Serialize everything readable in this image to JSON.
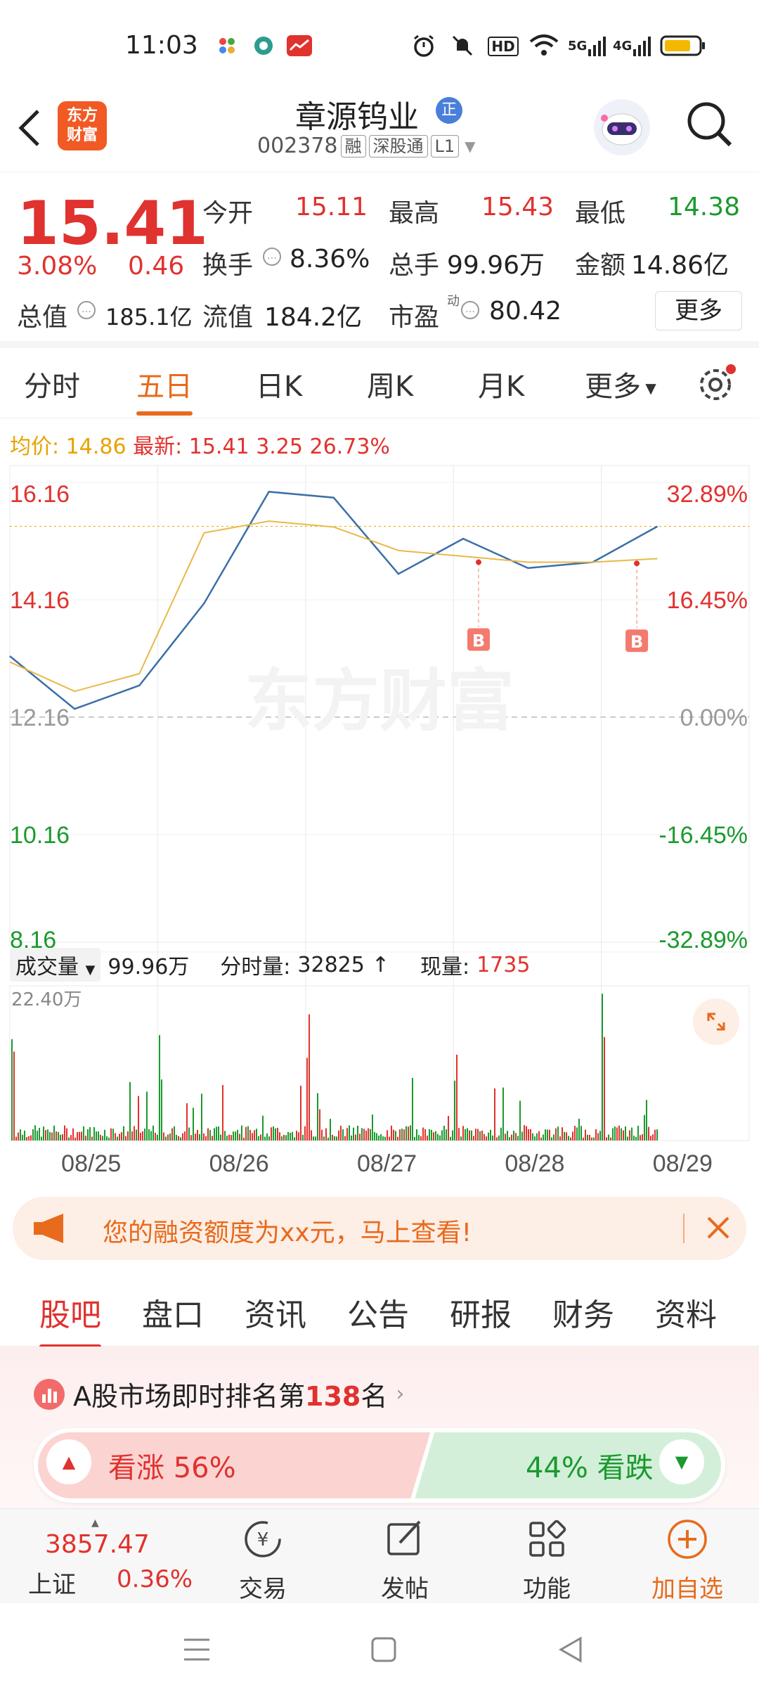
{
  "status_bar": {
    "time": "11:03",
    "net1": "5G",
    "net2": "4G",
    "hd": "HD"
  },
  "header": {
    "logo_line1": "东方",
    "logo_line2": "财富",
    "name": "章源钨业",
    "badge": "正",
    "code": "002378",
    "tags": [
      "融",
      "深股通",
      "L1"
    ]
  },
  "quote": {
    "price": "15.41",
    "change_pct": "3.08%",
    "change": "0.46",
    "open_label": "今开",
    "open": "15.11",
    "high_label": "最高",
    "high": "15.43",
    "low_label": "最低",
    "low": "14.38",
    "turnover_label": "换手",
    "turnover": "8.36%",
    "volume_label": "总手",
    "volume": "99.96万",
    "amount_label": "金额",
    "amount": "14.86亿",
    "mcap_label": "总值",
    "mcap": "185.1亿",
    "float_label": "流值",
    "float": "184.2亿",
    "pe_label": "市盈",
    "pe_sup": "动",
    "pe": "80.42",
    "more": "更多"
  },
  "ktabs": [
    "分时",
    "五日",
    "日K",
    "周K",
    "月K",
    "更多"
  ],
  "chart_info": {
    "avg_label": "均价:",
    "avg": "14.86",
    "latest_label": "最新:",
    "latest": "15.41",
    "chg": "3.25",
    "chg_pct": "26.73%"
  },
  "chart_data": {
    "type": "line",
    "x": [
      "08/25",
      "08/26",
      "08/27",
      "08/28",
      "08/29"
    ],
    "y_ticks_left": [
      "16.16",
      "14.16",
      "12.16",
      "10.16",
      "8.16"
    ],
    "y_ticks_right": [
      "32.89%",
      "16.45%",
      "0.00%",
      "-16.45%",
      "-32.89%"
    ],
    "ylim": [
      8.16,
      16.16
    ],
    "series": [
      {
        "values": [
          13.2,
          12.3,
          12.7,
          14.1,
          16.0,
          15.9,
          14.6,
          15.2,
          14.7,
          14.8,
          15.41
        ],
        "color": "#3b6fa8"
      },
      {
        "values": [
          13.1,
          12.6,
          12.9,
          15.3,
          15.5,
          15.4,
          15.0,
          14.9,
          14.8,
          14.8,
          14.86
        ],
        "color": "#e8b94a"
      }
    ],
    "markers": [
      "B",
      "B"
    ],
    "volume_label": "成交量",
    "volume_total": "99.96万",
    "tick_vol_label": "分时量:",
    "tick_vol": "32825",
    "now_vol_label": "现量:",
    "now_vol": "1735",
    "vol_max": "22.40万",
    "watermark": "东方财富"
  },
  "ad": {
    "text": "您的融资额度为xx元，马上查看!"
  },
  "content_tabs": [
    "股吧",
    "盘口",
    "资讯",
    "公告",
    "研报",
    "财务",
    "资料"
  ],
  "rank": {
    "prefix": "A股市场即时排名第",
    "num": "138",
    "suffix": "名"
  },
  "sentiment": {
    "up_label": "看涨 56%",
    "down_label": "44% 看跌",
    "up_pct": 56
  },
  "footer": {
    "index_value": "3857.47",
    "index_name": "上证",
    "index_pct": "0.36%",
    "items": [
      "交易",
      "发帖",
      "功能",
      "加自选"
    ]
  }
}
